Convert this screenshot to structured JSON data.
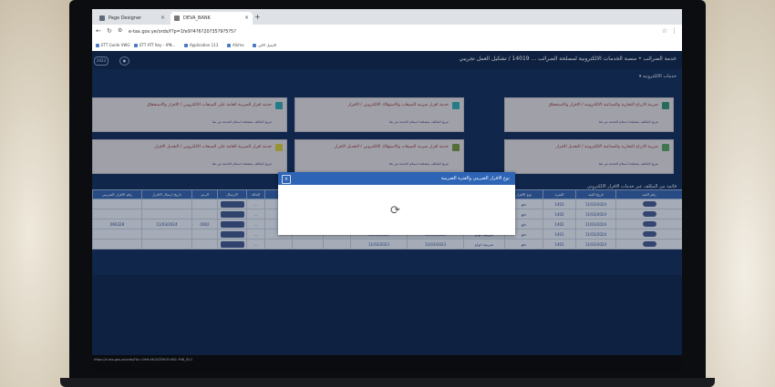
{
  "browser": {
    "tabs": [
      {
        "label": "Page Designer"
      },
      {
        "label": "DEVA_BANK"
      }
    ],
    "new_tab_symbol": "+",
    "url": "e-tax.gov.ye/ords/f?p=1fe9?4?6?20?35?9?5?5?",
    "bookmarks": [
      "ETT Guide VWG",
      "ETT ATT Key – IPN...",
      "Application 113",
      "Ali/mx",
      "الايميل الالي"
    ]
  },
  "app": {
    "header_title": "خدمة الضرائب • منصة الخدمات الالكترونية لمصلحة الضرائب ... 14019 / تشكيل العمل تجريبي",
    "year_pill": "2023",
    "subnav": "خدمات الالكترونية",
    "cards": [
      {
        "title": "ضريبة الارباح التجارية والصناعية الالكترونية / الاقرار والاستحقاق",
        "sub": "مزيج المكلف بمصلحة استلام الخدمة من هنا",
        "color": "#2e8b6b"
      },
      {
        "title": "خدمة اقرار ضريبة المبيعات والاستهلاك الالكتروني / الاقرار",
        "sub": "مزيج المكلف بمصلحة استلام الخدمة من هنا",
        "color": "#2ca0a8"
      },
      {
        "title": "خدمة اقرار الضريبة العامة على المبيعات الالكتروني / الاقرار والاستحقاق",
        "sub": "مزيج المكلف بمصلحة استلام الخدمة من هنا",
        "color": "#2ca0a8"
      },
      {
        "title": "ضريبة الارباح التجارية والصناعية الالكترونية / التعديل الاقرار",
        "sub": "مزيج المكلف بمصلحة استلام الخدمة من هنا",
        "color": "#4f9a5a"
      },
      {
        "title": "خدمة اقرار ضريبة المبيعات والاستهلاك الالكتروني / التعديل الاقرار",
        "sub": "مزيج المكلف بمصلحة استلام الخدمة من هنا",
        "color": "#6a8f3a"
      },
      {
        "title": "خدمة اقرار الضريبة العامة على المبيعات الالكتروني / التعديل الاقرار",
        "sub": "مزيج المكلف بمصلحة استلام الخدمة من هنا",
        "color": "#c9c23a"
      }
    ],
    "grid_title": "قائمة من المكلف عبر خدمات الاقرار الالكتروني",
    "columns": [
      "رقم الاقرار الضريبي",
      "تاريخ ارسال الاقرار",
      "الرمز",
      "الارسال",
      "الحالة",
      "",
      "",
      "",
      "",
      "مبلغ الضريبة",
      "نوع الضريبة",
      "نوع الاقرار",
      "الفترة",
      "تاريخ القيد",
      "رقم القيد"
    ],
    "rows": [
      {
        "r0": "",
        "r1": "",
        "r2": "",
        "r4": "",
        "r8": "",
        "r9": "",
        "r10": "ضريبية انواع",
        "r11": "دفع",
        "r12": "1403",
        "r13": "11/03/2024"
      },
      {
        "r0": "",
        "r1": "",
        "r2": "",
        "r4": "",
        "r8": "",
        "r9": "",
        "r10": "ضريبية انواع",
        "r11": "دفع",
        "r12": "1402",
        "r13": "11/03/2024"
      },
      {
        "r0": "066328",
        "r1": "11/03/2024",
        "r2": "0002",
        "r4": "",
        "r8": "11/03/2024",
        "r9": "11/03/2023",
        "r10": "ضريبية انواع",
        "r11": "دفع",
        "r12": "1402",
        "r13": "11/03/2024"
      },
      {
        "r0": "",
        "r1": "",
        "r2": "",
        "r4": "",
        "r8": "11/03/2023",
        "r9": "11/03/2023",
        "r10": "ضريبية انواع",
        "r11": "دفع",
        "r12": "1401",
        "r13": "11/03/2024"
      },
      {
        "r0": "",
        "r1": "",
        "r2": "",
        "r4": "",
        "r8": "11/03/2023",
        "r9": "11/03/2023",
        "r10": "ضريبية انواع",
        "r11": "دفع",
        "r12": "1401",
        "r13": "11/03/2024"
      }
    ],
    "status_line": "https://e-tax.gov.ye/ords/f?p=1fe9:46:20359:55:NO::P46_ID:1"
  },
  "modal": {
    "title": "نوع الاقرار الضريبي والفترة الضريبية",
    "close_symbol": "×",
    "spinner_symbol": "⟳"
  }
}
